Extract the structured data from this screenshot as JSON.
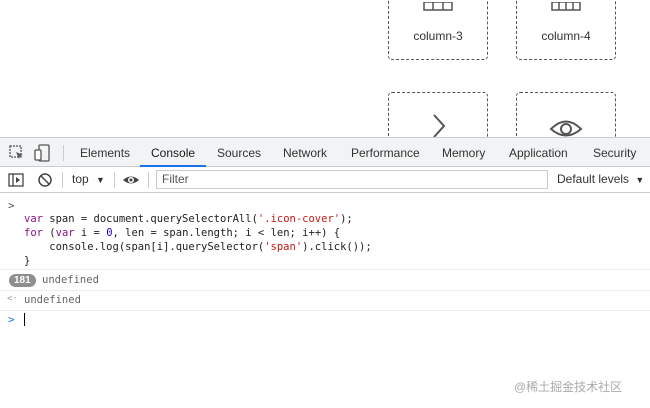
{
  "cards": [
    {
      "label": "column-3",
      "icon": "column-table-icon"
    },
    {
      "label": "column-4",
      "icon": "column-table-icon"
    },
    {
      "label": "",
      "icon": "chevron-right-icon"
    },
    {
      "label": "",
      "icon": "eye-icon"
    }
  ],
  "devtools": {
    "tabs": [
      "Elements",
      "Console",
      "Sources",
      "Network",
      "Performance",
      "Memory",
      "Application",
      "Security"
    ],
    "active_tab": "Console",
    "context": "top",
    "filter_placeholder": "Filter",
    "levels": "Default levels"
  },
  "console": {
    "input_prompt": ">",
    "code": {
      "l1a": "var",
      "l1b": " span = document.querySelectorAll(",
      "l1c": "'.icon-cover'",
      "l1d": ");",
      "l2a": "for",
      "l2b": " (",
      "l2c": "var",
      "l2d": " i = ",
      "l2e": "0",
      "l2f": ", len = span.length; i < len; i++) {",
      "l3a": "    console.log(span[i].querySelector(",
      "l3b": "'span'",
      "l3c": ").click());",
      "l4": "}"
    },
    "repeat_count": "181",
    "log_output": "undefined",
    "result_prompt": "<·",
    "result_value": "undefined",
    "active_prompt": ">"
  },
  "watermark": "@稀土掘金技术社区"
}
